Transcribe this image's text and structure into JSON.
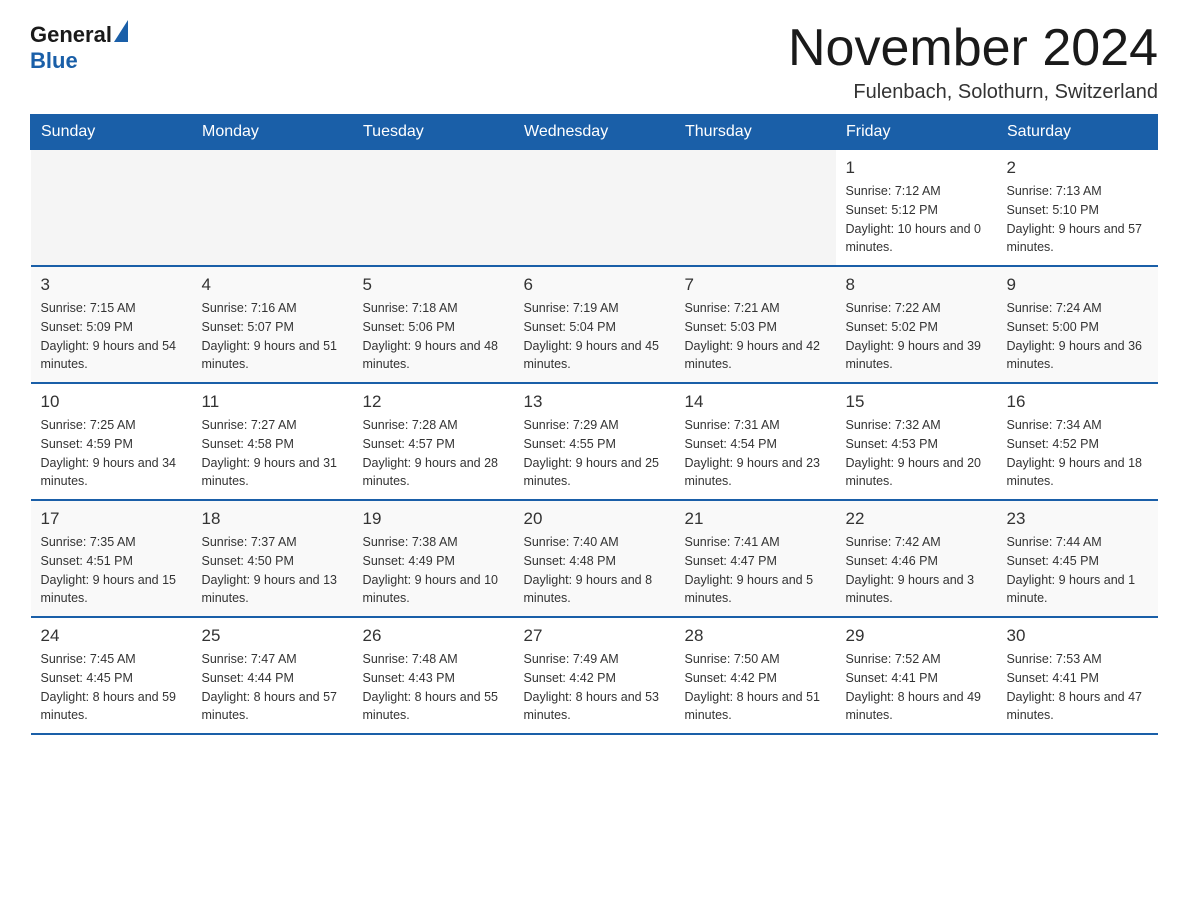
{
  "header": {
    "logo_general": "General",
    "logo_blue": "Blue",
    "month_title": "November 2024",
    "location": "Fulenbach, Solothurn, Switzerland"
  },
  "days_of_week": [
    "Sunday",
    "Monday",
    "Tuesday",
    "Wednesday",
    "Thursday",
    "Friday",
    "Saturday"
  ],
  "weeks": [
    [
      {
        "day": "",
        "info": ""
      },
      {
        "day": "",
        "info": ""
      },
      {
        "day": "",
        "info": ""
      },
      {
        "day": "",
        "info": ""
      },
      {
        "day": "",
        "info": ""
      },
      {
        "day": "1",
        "info": "Sunrise: 7:12 AM\nSunset: 5:12 PM\nDaylight: 10 hours and 0 minutes."
      },
      {
        "day": "2",
        "info": "Sunrise: 7:13 AM\nSunset: 5:10 PM\nDaylight: 9 hours and 57 minutes."
      }
    ],
    [
      {
        "day": "3",
        "info": "Sunrise: 7:15 AM\nSunset: 5:09 PM\nDaylight: 9 hours and 54 minutes."
      },
      {
        "day": "4",
        "info": "Sunrise: 7:16 AM\nSunset: 5:07 PM\nDaylight: 9 hours and 51 minutes."
      },
      {
        "day": "5",
        "info": "Sunrise: 7:18 AM\nSunset: 5:06 PM\nDaylight: 9 hours and 48 minutes."
      },
      {
        "day": "6",
        "info": "Sunrise: 7:19 AM\nSunset: 5:04 PM\nDaylight: 9 hours and 45 minutes."
      },
      {
        "day": "7",
        "info": "Sunrise: 7:21 AM\nSunset: 5:03 PM\nDaylight: 9 hours and 42 minutes."
      },
      {
        "day": "8",
        "info": "Sunrise: 7:22 AM\nSunset: 5:02 PM\nDaylight: 9 hours and 39 minutes."
      },
      {
        "day": "9",
        "info": "Sunrise: 7:24 AM\nSunset: 5:00 PM\nDaylight: 9 hours and 36 minutes."
      }
    ],
    [
      {
        "day": "10",
        "info": "Sunrise: 7:25 AM\nSunset: 4:59 PM\nDaylight: 9 hours and 34 minutes."
      },
      {
        "day": "11",
        "info": "Sunrise: 7:27 AM\nSunset: 4:58 PM\nDaylight: 9 hours and 31 minutes."
      },
      {
        "day": "12",
        "info": "Sunrise: 7:28 AM\nSunset: 4:57 PM\nDaylight: 9 hours and 28 minutes."
      },
      {
        "day": "13",
        "info": "Sunrise: 7:29 AM\nSunset: 4:55 PM\nDaylight: 9 hours and 25 minutes."
      },
      {
        "day": "14",
        "info": "Sunrise: 7:31 AM\nSunset: 4:54 PM\nDaylight: 9 hours and 23 minutes."
      },
      {
        "day": "15",
        "info": "Sunrise: 7:32 AM\nSunset: 4:53 PM\nDaylight: 9 hours and 20 minutes."
      },
      {
        "day": "16",
        "info": "Sunrise: 7:34 AM\nSunset: 4:52 PM\nDaylight: 9 hours and 18 minutes."
      }
    ],
    [
      {
        "day": "17",
        "info": "Sunrise: 7:35 AM\nSunset: 4:51 PM\nDaylight: 9 hours and 15 minutes."
      },
      {
        "day": "18",
        "info": "Sunrise: 7:37 AM\nSunset: 4:50 PM\nDaylight: 9 hours and 13 minutes."
      },
      {
        "day": "19",
        "info": "Sunrise: 7:38 AM\nSunset: 4:49 PM\nDaylight: 9 hours and 10 minutes."
      },
      {
        "day": "20",
        "info": "Sunrise: 7:40 AM\nSunset: 4:48 PM\nDaylight: 9 hours and 8 minutes."
      },
      {
        "day": "21",
        "info": "Sunrise: 7:41 AM\nSunset: 4:47 PM\nDaylight: 9 hours and 5 minutes."
      },
      {
        "day": "22",
        "info": "Sunrise: 7:42 AM\nSunset: 4:46 PM\nDaylight: 9 hours and 3 minutes."
      },
      {
        "day": "23",
        "info": "Sunrise: 7:44 AM\nSunset: 4:45 PM\nDaylight: 9 hours and 1 minute."
      }
    ],
    [
      {
        "day": "24",
        "info": "Sunrise: 7:45 AM\nSunset: 4:45 PM\nDaylight: 8 hours and 59 minutes."
      },
      {
        "day": "25",
        "info": "Sunrise: 7:47 AM\nSunset: 4:44 PM\nDaylight: 8 hours and 57 minutes."
      },
      {
        "day": "26",
        "info": "Sunrise: 7:48 AM\nSunset: 4:43 PM\nDaylight: 8 hours and 55 minutes."
      },
      {
        "day": "27",
        "info": "Sunrise: 7:49 AM\nSunset: 4:42 PM\nDaylight: 8 hours and 53 minutes."
      },
      {
        "day": "28",
        "info": "Sunrise: 7:50 AM\nSunset: 4:42 PM\nDaylight: 8 hours and 51 minutes."
      },
      {
        "day": "29",
        "info": "Sunrise: 7:52 AM\nSunset: 4:41 PM\nDaylight: 8 hours and 49 minutes."
      },
      {
        "day": "30",
        "info": "Sunrise: 7:53 AM\nSunset: 4:41 PM\nDaylight: 8 hours and 47 minutes."
      }
    ]
  ]
}
